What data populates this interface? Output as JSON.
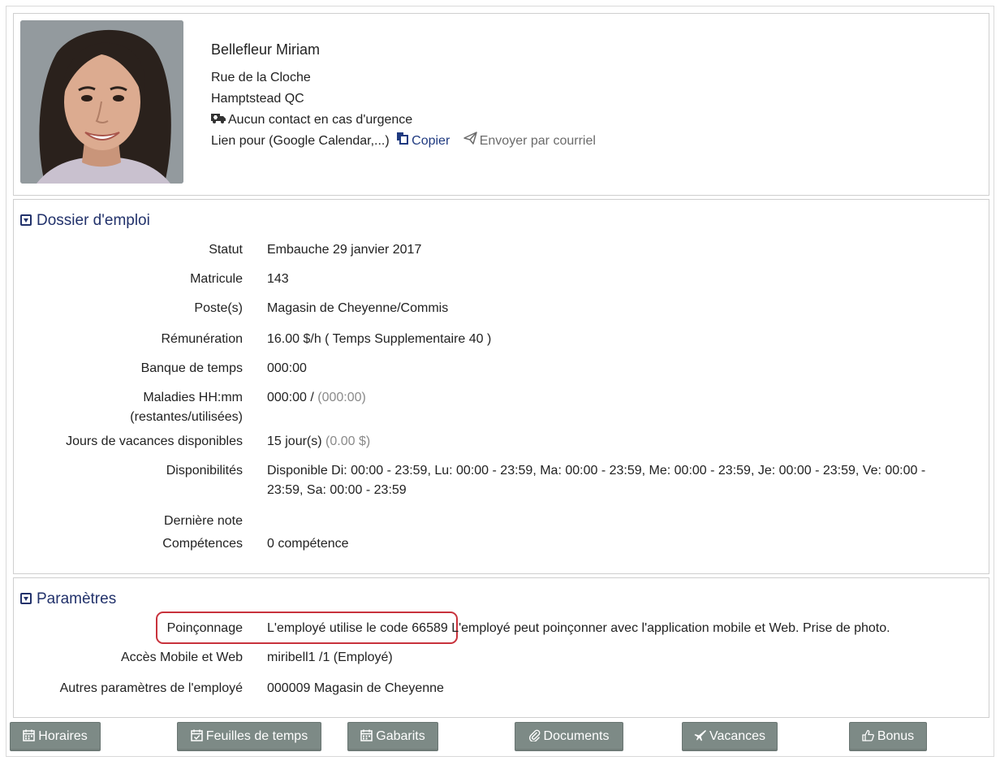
{
  "profile": {
    "name": "Bellefleur Miriam",
    "street": "Rue de la Cloche",
    "city": "Hamptstead QC",
    "emergency": "Aucun contact en cas d'urgence",
    "link_label": "Lien pour (Google Calendar,...)",
    "copy_label": "Copier",
    "email_label": "Envoyer par courriel"
  },
  "dossier": {
    "title": "Dossier d'emploi",
    "rows": [
      {
        "label": "Statut",
        "value": "Embauche 29 janvier 2017"
      },
      {
        "label": "Matricule",
        "value": "143"
      },
      {
        "label": "Poste(s)",
        "value": "Magasin de Cheyenne/Commis"
      },
      {
        "label": "Rémunération",
        "value": "16.00 $/h ( Temps Supplementaire 40 )"
      },
      {
        "label": "Banque de temps",
        "value": "000:00"
      },
      {
        "label_line1": "Maladies HH:mm",
        "label_line2": "(restantes/utilisées)",
        "value": "000:00 / ",
        "value_muted": "(000:00)"
      },
      {
        "label": "Jours de vacances disponibles",
        "value": "15 jour(s) ",
        "value_muted": "(0.00 $)"
      },
      {
        "label": "Disponibilités",
        "value_line1": "Disponible Di: 00:00 - 23:59, Lu: 00:00 - 23:59, Ma: 00:00 - 23:59, Me: 00:00 - 23:59, Je: 00:00 - 23:59, Ve: 00:00 -",
        "value_line2": "23:59, Sa: 00:00 - 23:59"
      },
      {
        "label": "Dernière note",
        "value": ""
      },
      {
        "label": "Compétences",
        "value": "0 compétence"
      }
    ]
  },
  "params": {
    "title": "Paramètres",
    "rows": [
      {
        "label": "Poinçonnage",
        "value": "L'employé utilise le code 66589 L'employé peut poinçonner avec l'application mobile et Web. Prise de photo."
      },
      {
        "label": "Accès Mobile et Web",
        "value": "miribell1 /1 (Employé)"
      },
      {
        "label": "Autres paramètres de l'employé",
        "value": "000009 Magasin de Cheyenne"
      }
    ]
  },
  "buttons": [
    {
      "label": "Horaires",
      "icon": "calendar-icon"
    },
    {
      "label": "Feuilles de temps",
      "icon": "calendar-check-icon"
    },
    {
      "label": "Gabarits",
      "icon": "calendar-icon"
    },
    {
      "label": "Documents",
      "icon": "paperclip-icon"
    },
    {
      "label": "Vacances",
      "icon": "plane-icon"
    },
    {
      "label": "Bonus",
      "icon": "thumbs-up-icon"
    }
  ],
  "colors": {
    "heading": "#22326b",
    "link": "#1f3a80",
    "button_bg": "#7d8a86",
    "highlight": "#c8323c"
  }
}
